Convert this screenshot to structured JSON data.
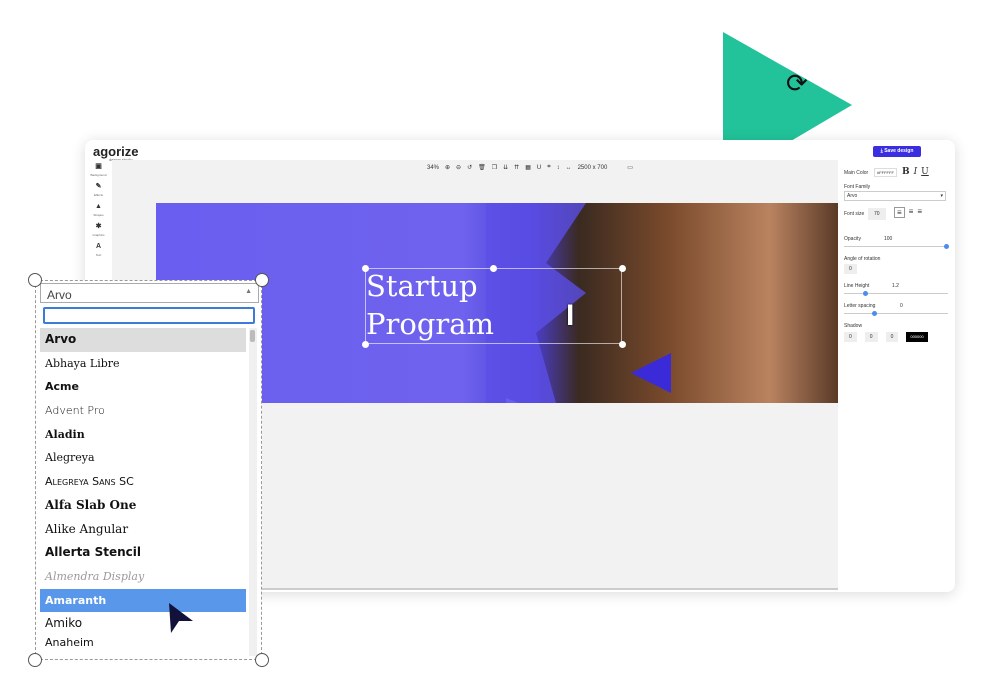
{
  "app": {
    "logo": "agorize",
    "logo_sub": "design studio"
  },
  "sidebar": {
    "items": [
      {
        "icon": "image-icon",
        "label": "Background"
      },
      {
        "icon": "magic-wand-icon",
        "label": "Effects"
      },
      {
        "icon": "shapes-icon",
        "label": "Shapes"
      },
      {
        "icon": "graphics-icon",
        "label": "Graphics"
      },
      {
        "icon": "text-icon",
        "label": "Text"
      }
    ]
  },
  "toolbar": {
    "zoom": "34%",
    "dimensions": "2500 x 700"
  },
  "canvas": {
    "title_line1": "Startup",
    "title_line2": "Program"
  },
  "panel": {
    "save_label": "Save design",
    "main_color_label": "Main Color",
    "main_color_value": "#FFFFFF",
    "bold": "B",
    "italic": "I",
    "underline": "U",
    "font_family_label": "Font Family",
    "font_family_value": "Arvo",
    "font_size_label": "Font size",
    "font_size_value": "70",
    "opacity_label": "Opacity",
    "opacity_value": "100",
    "rotation_label": "Angle of rotation",
    "rotation_value": "0",
    "line_height_label": "Line Height",
    "line_height_value": "1.2",
    "letter_spacing_label": "Letter spacing",
    "letter_spacing_value": "0",
    "shadow_label": "Shadow",
    "shadow_x": "0",
    "shadow_y": "0",
    "shadow_blur": "0",
    "shadow_color": "000000"
  },
  "font_dropdown": {
    "selected": "Arvo",
    "search_value": "",
    "options": [
      "Arvo",
      "Abhaya Libre",
      "Acme",
      "Advent Pro",
      "Aladin",
      "Alegreya",
      "Alegreya Sans SC",
      "Alfa Slab One",
      "Alike Angular",
      "Allerta Stencil",
      "Almendra Display",
      "Amaranth",
      "Amiko",
      "Anaheim"
    ],
    "highlighted": "Amaranth"
  },
  "colors": {
    "accent_green": "#22c39a",
    "brand_purple": "#3b2ee0",
    "highlight": "#5897ea"
  }
}
